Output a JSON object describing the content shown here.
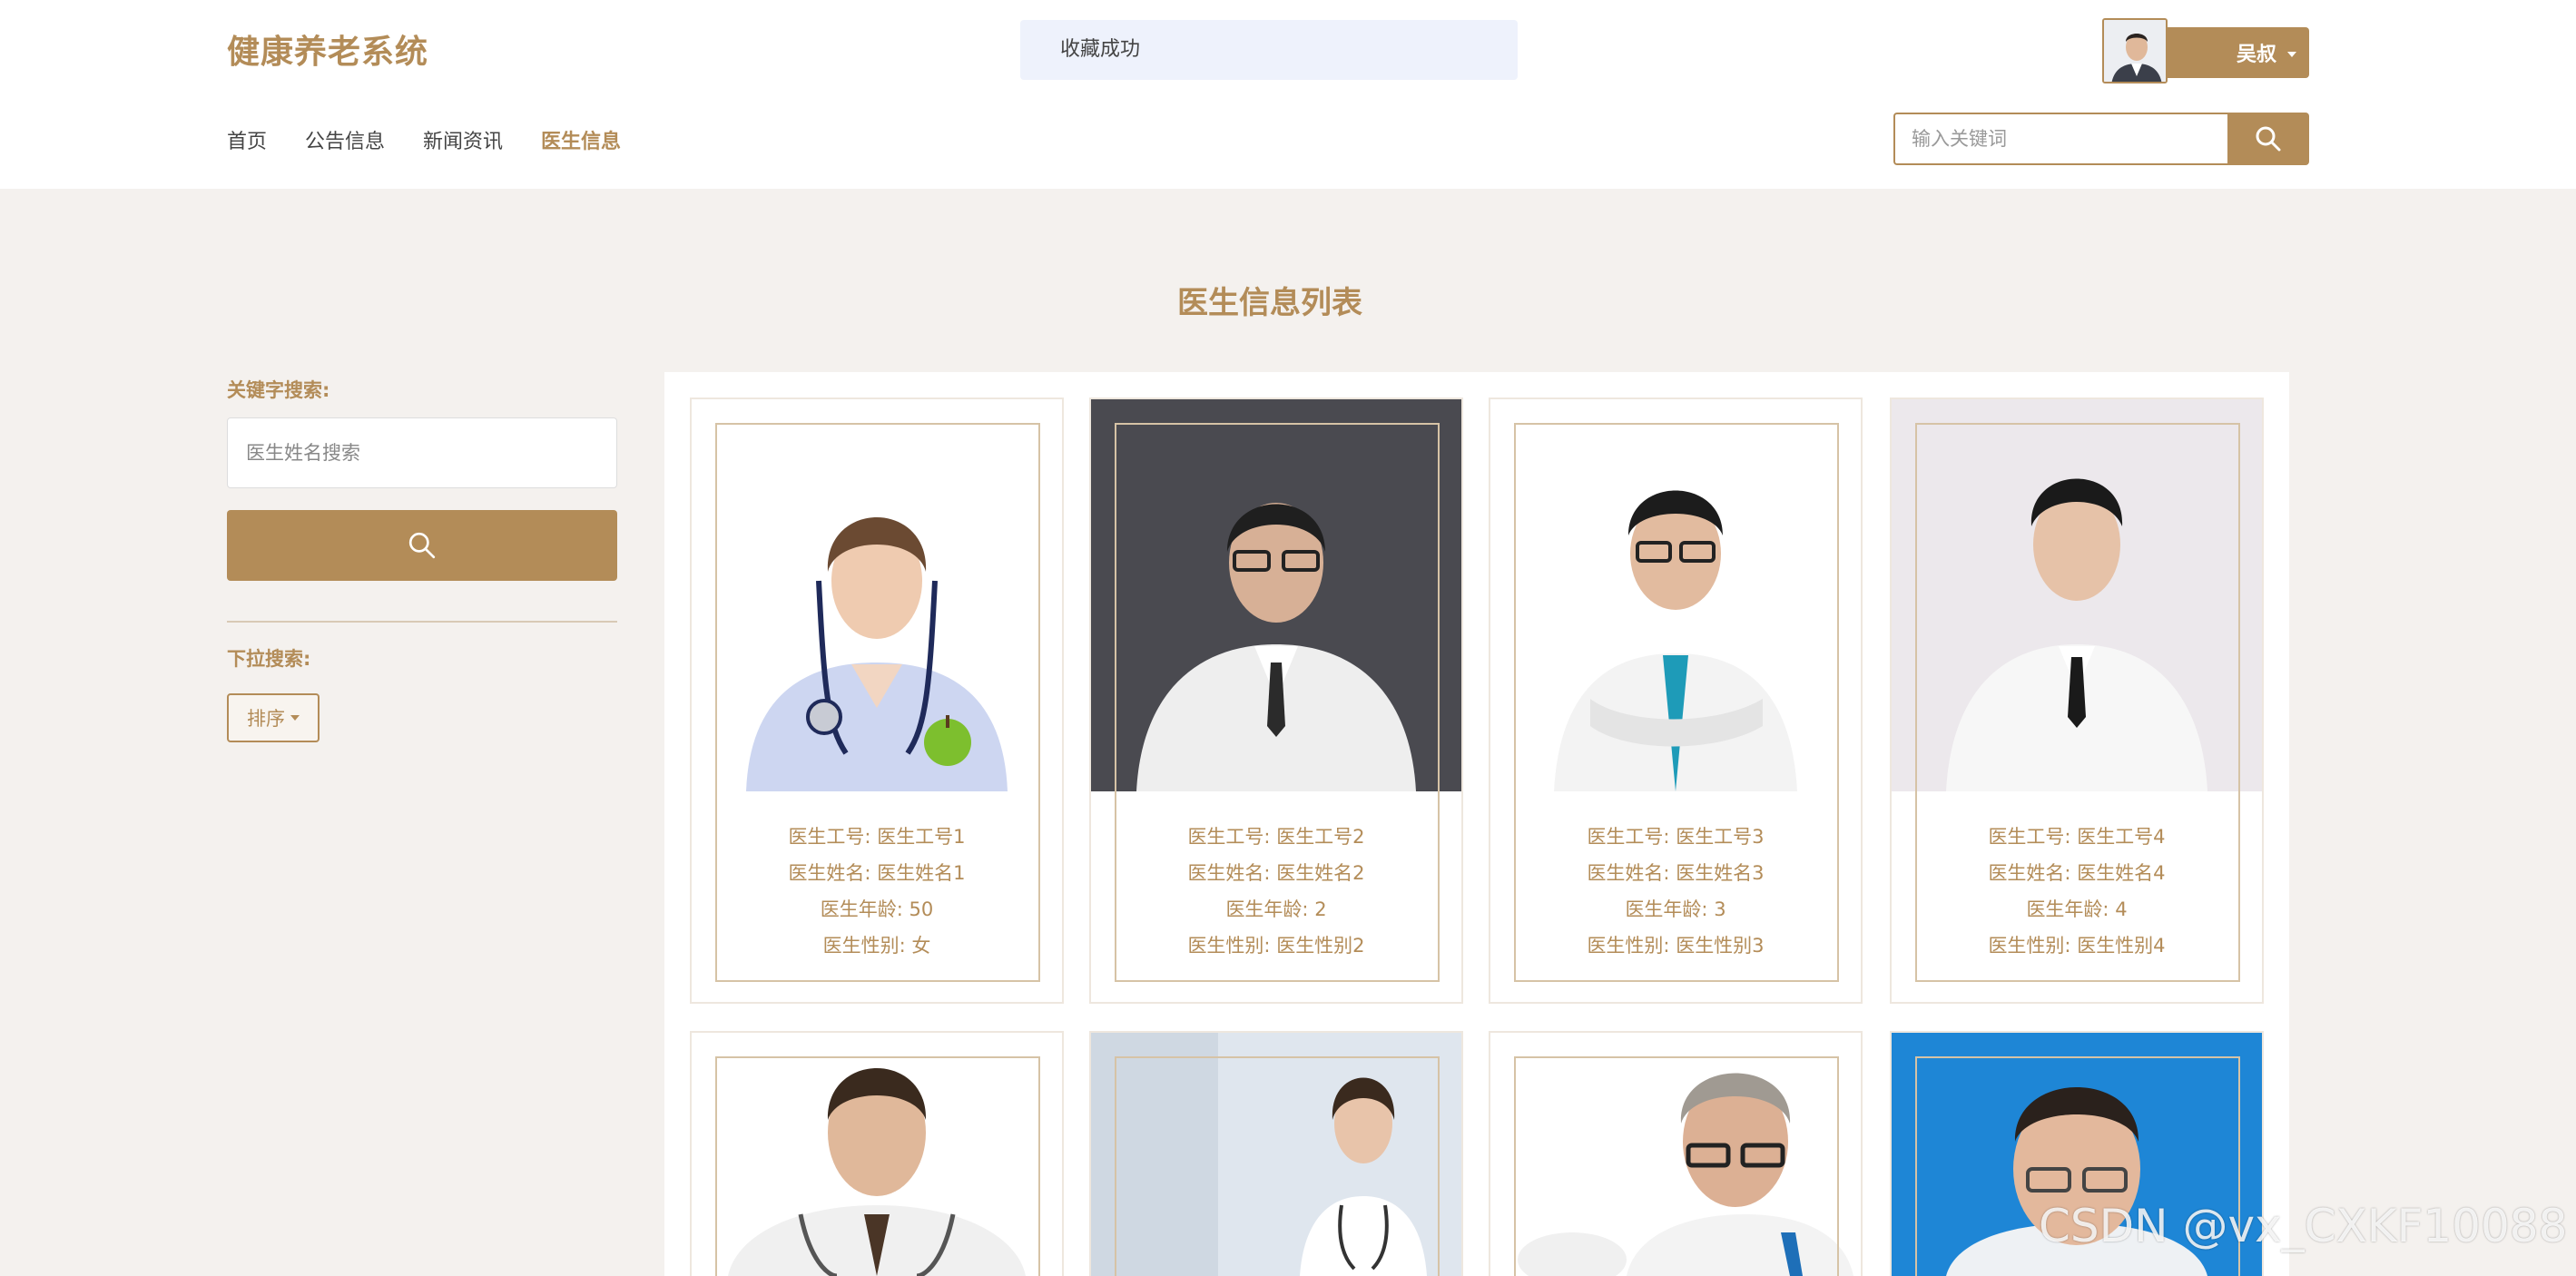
{
  "app": {
    "title": "健康养老系统"
  },
  "toast": {
    "message": "收藏成功"
  },
  "nav": {
    "items": [
      "首页",
      "公告信息",
      "新闻资讯",
      "医生信息"
    ],
    "active": "医生信息"
  },
  "user": {
    "name": "吴叔"
  },
  "header_search": {
    "placeholder": "输入关键词"
  },
  "page": {
    "title": "医生信息列表"
  },
  "sidebar": {
    "keyword_label": "关键字搜索:",
    "keyword_placeholder": "医生姓名搜索",
    "dropdown_label": "下拉搜索:",
    "sort_label": "排序"
  },
  "doctors": [
    {
      "id_label": "医生工号: 医生工号1",
      "name_label": "医生姓名: 医生姓名1",
      "age_label": "医生年龄: 50",
      "gender_label": "医生性别: 女",
      "photo": "female-doctor-with-apple"
    },
    {
      "id_label": "医生工号: 医生工号2",
      "name_label": "医生姓名: 医生姓名2",
      "age_label": "医生年龄: 2",
      "gender_label": "医生性别: 医生性别2",
      "photo": "male-doctor-dark-bg"
    },
    {
      "id_label": "医生工号: 医生工号3",
      "name_label": "医生姓名: 医生姓名3",
      "age_label": "医生年龄: 3",
      "gender_label": "医生性别: 医生性别3",
      "photo": "male-doctor-arms-crossed"
    },
    {
      "id_label": "医生工号: 医生工号4",
      "name_label": "医生姓名: 医生姓名4",
      "age_label": "医生年龄: 4",
      "gender_label": "医生性别: 医生性别4",
      "photo": "male-doctor-standing"
    }
  ],
  "doctors_row2": [
    {
      "photo": "male-doctor-stethoscope"
    },
    {
      "photo": "female-doctor-blur-bg"
    },
    {
      "photo": "older-male-doctor-glasses"
    },
    {
      "photo": "male-doctor-blue-bg"
    }
  ],
  "watermark": "CSDN @vx_CXKF10088",
  "colors": {
    "accent": "#b38c58",
    "page_bg": "#f4f1ee",
    "toast_bg": "#eef2fc"
  }
}
